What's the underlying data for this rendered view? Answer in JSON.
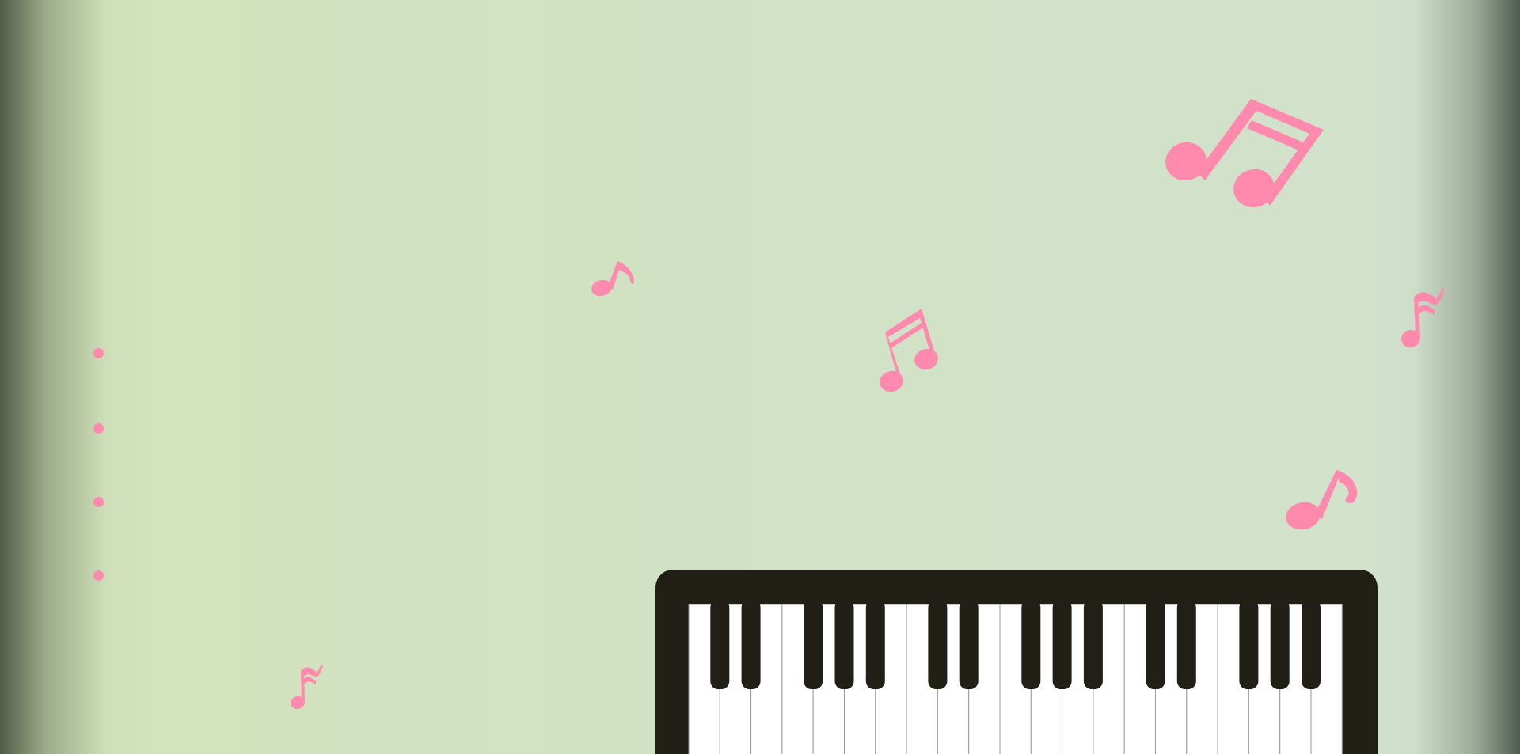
{
  "colors": {
    "accent": "#ff8aae",
    "piano_frame": "#221f16",
    "white_key": "#ffffff",
    "key_divider": "#9a9a9a",
    "background": "#d3e3c4"
  },
  "nav": {
    "dots": [
      {
        "id": "nav-dot-1"
      },
      {
        "id": "nav-dot-2"
      },
      {
        "id": "nav-dot-3"
      },
      {
        "id": "nav-dot-4"
      }
    ]
  },
  "decorations": {
    "notes": [
      "beamed-eighth-notes-icon",
      "eighth-note-icon",
      "sixteenth-note-icon"
    ]
  },
  "piano": {
    "icon": "piano-keyboard-icon",
    "white_keys": 21,
    "black_key_pattern": [
      1,
      1,
      0,
      1,
      1,
      1,
      0
    ]
  }
}
